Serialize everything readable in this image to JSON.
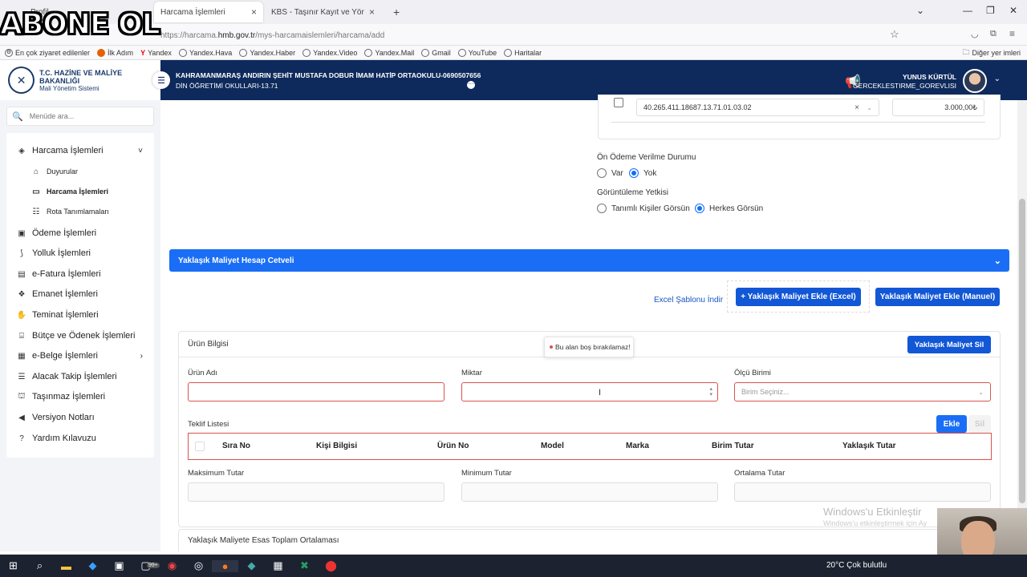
{
  "browser": {
    "tabs": [
      {
        "label": "Profil"
      },
      {
        "label": "Harcama İşlemleri"
      },
      {
        "label": "KBS - Taşınır Kayıt ve Yönetim Sisteı"
      }
    ],
    "url_prefix": "https://harcama.",
    "url_domain": "hmb.gov.tr",
    "url_rest": "/mys-harcamaislemleri/harcama/add",
    "bookmarks": [
      "En çok ziyaret edilenler",
      "İlk Adım",
      "Yandex",
      "Yandex.Hava",
      "Yandex.Haber",
      "Yandex.Video",
      "Yandex.Mail",
      "Gmail",
      "YouTube",
      "Haritalar"
    ],
    "other_bookmarks": "Diğer yer imleri"
  },
  "overlay_text": "ABONE OL",
  "logo": {
    "line1": "T.C. HAZİNE VE MALİYE BAKANLIĞI",
    "line2": "Mali Yönetim Sistemi"
  },
  "header": {
    "unit_line1": "KAHRAMANMARAŞ ANDIRIN ŞEHİT MUSTAFA DOBUR İMAM HATİP ORTAOKULU-0690507656",
    "unit_line2": "DİN ÖĞRETİMİ OKULLARI-13.71",
    "user_name": "YUNUS KÜRTÜL",
    "user_role": "GERCEKLESTIRME_GOREVLISI"
  },
  "sidebar": {
    "search_placeholder": "Menüde ara...",
    "items": [
      {
        "label": "Harcama İşlemleri",
        "icon": "stack-icon",
        "chevron": "˅"
      },
      {
        "label": "Duyurular",
        "icon": "home-icon"
      },
      {
        "label": "Harcama İşlemleri",
        "icon": "card-icon"
      },
      {
        "label": "Rota Tanımlamaları",
        "icon": "list-icon"
      },
      {
        "label": "Ödeme İşlemleri",
        "icon": "money-icon"
      },
      {
        "label": "Yolluk İşlemleri",
        "icon": "road-icon"
      },
      {
        "label": "e-Fatura İşlemleri",
        "icon": "invoice-icon"
      },
      {
        "label": "Emanet İşlemleri",
        "icon": "box-icon"
      },
      {
        "label": "Teminat İşlemleri",
        "icon": "handshake-icon"
      },
      {
        "label": "Bütçe ve Ödenek İşlemleri",
        "icon": "bank-icon"
      },
      {
        "label": "e-Belge İşlemleri",
        "icon": "document-icon",
        "chevron": "›"
      },
      {
        "label": "Alacak Takip İşlemleri",
        "icon": "tasks-icon"
      },
      {
        "label": "Taşınmaz İşlemleri",
        "icon": "building-icon"
      },
      {
        "label": "Versiyon Notları",
        "icon": "megaphone-icon"
      },
      {
        "label": "Yardım Kılavuzu",
        "icon": "question-icon"
      }
    ]
  },
  "budget": {
    "code": "40.265.411.18687.13.71.01.03.02",
    "amount": "3.000,00₺"
  },
  "prepayment": {
    "label": "Ön Ödeme Verilme Durumu",
    "opt_yes": "Var",
    "opt_no": "Yok",
    "selected": "Yok"
  },
  "visibility": {
    "label": "Görüntüleme Yetkisi",
    "opt_defined": "Tanımlı Kişiler Görsün",
    "opt_all": "Herkes Görsün",
    "selected": "Herkes Görsün"
  },
  "section": {
    "title": "Yaklaşık Maliyet Hesap Cetveli"
  },
  "actions": {
    "excel_template": "Excel Şablonu İndir",
    "add_excel": "+ Yaklaşık Maliyet Ekle (Excel)",
    "add_manual": "Yaklaşık Maliyet Ekle (Manuel)"
  },
  "product": {
    "title": "Ürün Bilgisi",
    "delete_btn": "Yaklaşık Maliyet Sil",
    "tooltip": "Bu alan boş bırakılamaz!",
    "name_label": "Ürün Adı",
    "qty_label": "Miktar",
    "unit_label": "Ölçü Birimi",
    "unit_placeholder": "Birim Seçiniz..."
  },
  "offers": {
    "label": "Teklif Listesi",
    "add_btn": "Ekle",
    "del_btn": "Sil",
    "columns": [
      "Sıra No",
      "Kişi Bilgisi",
      "Ürün No",
      "Model",
      "Marka",
      "Birim Tutar",
      "Yaklaşık Tutar"
    ]
  },
  "totals": {
    "max": "Maksimum Tutar",
    "min": "Minimum Tutar",
    "avg": "Ortalama Tutar",
    "basis": "Yaklaşık Maliyete Esas Toplam Ortalaması"
  },
  "watermark": {
    "line1": "Windows'u Etkinleştir",
    "line2": "Windows'u etkinleştirmek için Ay"
  },
  "taskbar": {
    "weather": "20°C  Çok bulutlu",
    "badge": "99+"
  }
}
